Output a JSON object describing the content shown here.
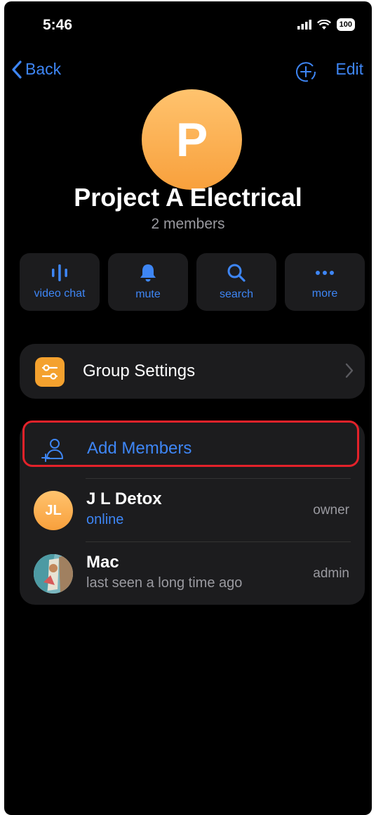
{
  "status": {
    "time": "5:46",
    "battery": "100"
  },
  "nav": {
    "back_label": "Back",
    "edit_label": "Edit"
  },
  "group": {
    "initial": "P",
    "name": "Project A Electrical",
    "members_count": "2 members"
  },
  "actions": [
    {
      "label": "video chat",
      "icon": "voice-wave-icon"
    },
    {
      "label": "mute",
      "icon": "bell-icon"
    },
    {
      "label": "search",
      "icon": "search-icon"
    },
    {
      "label": "more",
      "icon": "ellipsis-icon"
    }
  ],
  "settings": {
    "label": "Group Settings",
    "icon": "sliders-icon"
  },
  "members": {
    "add_label": "Add Members",
    "list": [
      {
        "initials": "JL",
        "name": "J L Detox",
        "status": "online",
        "role": "owner"
      },
      {
        "initials": "",
        "name": "Mac",
        "status": "last seen a long time ago",
        "role": "admin"
      }
    ]
  },
  "colors": {
    "accent": "#3e86f5",
    "avatar": "#f8a03c",
    "highlight": "#e3222a",
    "card": "#1c1c1e"
  }
}
